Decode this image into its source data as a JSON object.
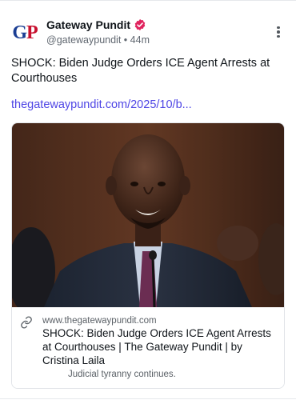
{
  "author": {
    "avatar_letters": "G",
    "avatar_letters_2": "P",
    "display_name": "Gateway Pundit",
    "handle": "@gatewaypundit",
    "separator": "•",
    "time_ago": "44m"
  },
  "post": {
    "text": "SHOCK: Biden Judge Orders ICE Agent Arrests at Courthouses",
    "link_text": "thegatewaypundit.com/2025/10/b..."
  },
  "link_card": {
    "domain": "www.thegatewaypundit.com",
    "title": "SHOCK: Biden Judge Orders ICE Agent Arrests at Courthouses | The Gateway Pundit | by Cristina Laila",
    "description": "Judicial tyranny continues."
  },
  "icons": {
    "verified": "verified-badge-icon",
    "menu": "more-vertical-icon",
    "link": "link-icon"
  },
  "colors": {
    "link": "#4f46e5",
    "verified": "#e0245e",
    "avatar_blue": "#1b3e93",
    "avatar_red": "#c8102e"
  }
}
